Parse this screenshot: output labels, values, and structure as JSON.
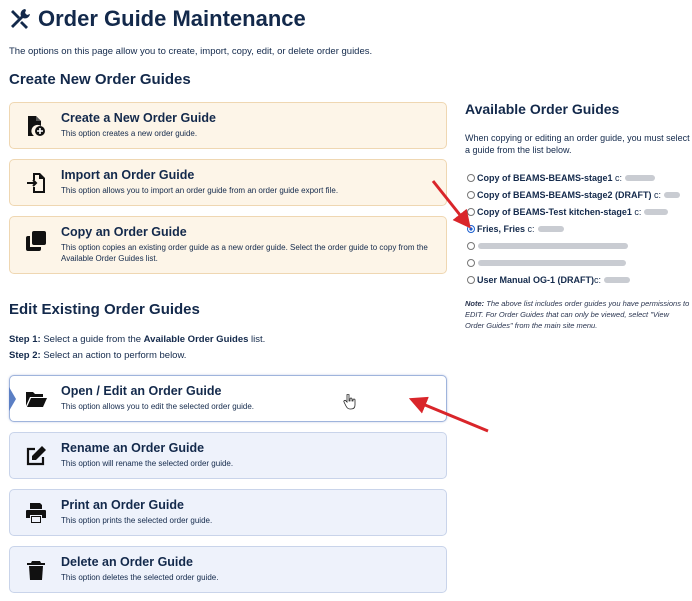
{
  "page": {
    "title": "Order Guide Maintenance",
    "intro": "The options on this page allow you to create, import, copy, edit, or delete order guides."
  },
  "create_section": {
    "heading": "Create New Order Guides",
    "cards": [
      {
        "title": "Create a New Order Guide",
        "desc": "This option creates a new order guide.",
        "icon": "new-file-icon"
      },
      {
        "title": "Import an Order Guide",
        "desc": "This option allows you to import an order guide from an order guide export file.",
        "icon": "import-icon"
      },
      {
        "title": "Copy an Order Guide",
        "desc": "This option copies an existing order guide as a new order guide. Select the order guide to copy from the Available Order Guides list.",
        "icon": "copy-icon"
      }
    ]
  },
  "edit_section": {
    "heading": "Edit Existing Order Guides",
    "step1_label": "Step 1:",
    "step1_pre": " Select a guide from the ",
    "step1_bold": "Available Order Guides",
    "step1_post": " list.",
    "step2_label": "Step 2:",
    "step2_text": " Select an action to perform below.",
    "cards": [
      {
        "title": "Open / Edit an Order Guide",
        "desc": "This option allows you to edit the selected order guide.",
        "icon": "folder-open-icon",
        "active": true
      },
      {
        "title": "Rename an Order Guide",
        "desc": "This option will rename the selected order guide.",
        "icon": "edit-icon"
      },
      {
        "title": "Print an Order Guide",
        "desc": "This option prints the selected order guide.",
        "icon": "print-icon"
      },
      {
        "title": "Delete an Order Guide",
        "desc": "This option deletes the selected order guide.",
        "icon": "trash-icon"
      }
    ]
  },
  "available": {
    "heading": "Available Order Guides",
    "description": "When copying or editing an order guide, you must select a guide from the list below.",
    "guides": [
      {
        "name": "Copy of BEAMS-BEAMS-stage1",
        "suffix": "c:",
        "selected": false
      },
      {
        "name": "Copy of BEAMS-BEAMS-stage2 (DRAFT)",
        "suffix": "c:",
        "selected": false
      },
      {
        "name": "Copy of BEAMS-Test kitchen-stage1",
        "suffix": "c:",
        "selected": false
      },
      {
        "name": "Fries, Fries",
        "suffix": "c:",
        "selected": true
      },
      {
        "name": "",
        "suffix": "",
        "selected": false
      },
      {
        "name": "",
        "suffix": "",
        "selected": false
      },
      {
        "name": "User Manual OG-1 (DRAFT)",
        "suffix": "c:",
        "selected": false
      }
    ],
    "note_label": "Note:",
    "note_text": " The above list includes order guides you have permissions to EDIT. For Order Guides that can only be viewed, select \"View Order Guides\" from the main site menu."
  },
  "colors": {
    "heading": "#13294b",
    "create_card_bg": "#fdf5e8",
    "edit_card_bg": "#eef2fb",
    "annotation_arrow": "#d9252a",
    "radio_selected": "#1a5fd0"
  }
}
